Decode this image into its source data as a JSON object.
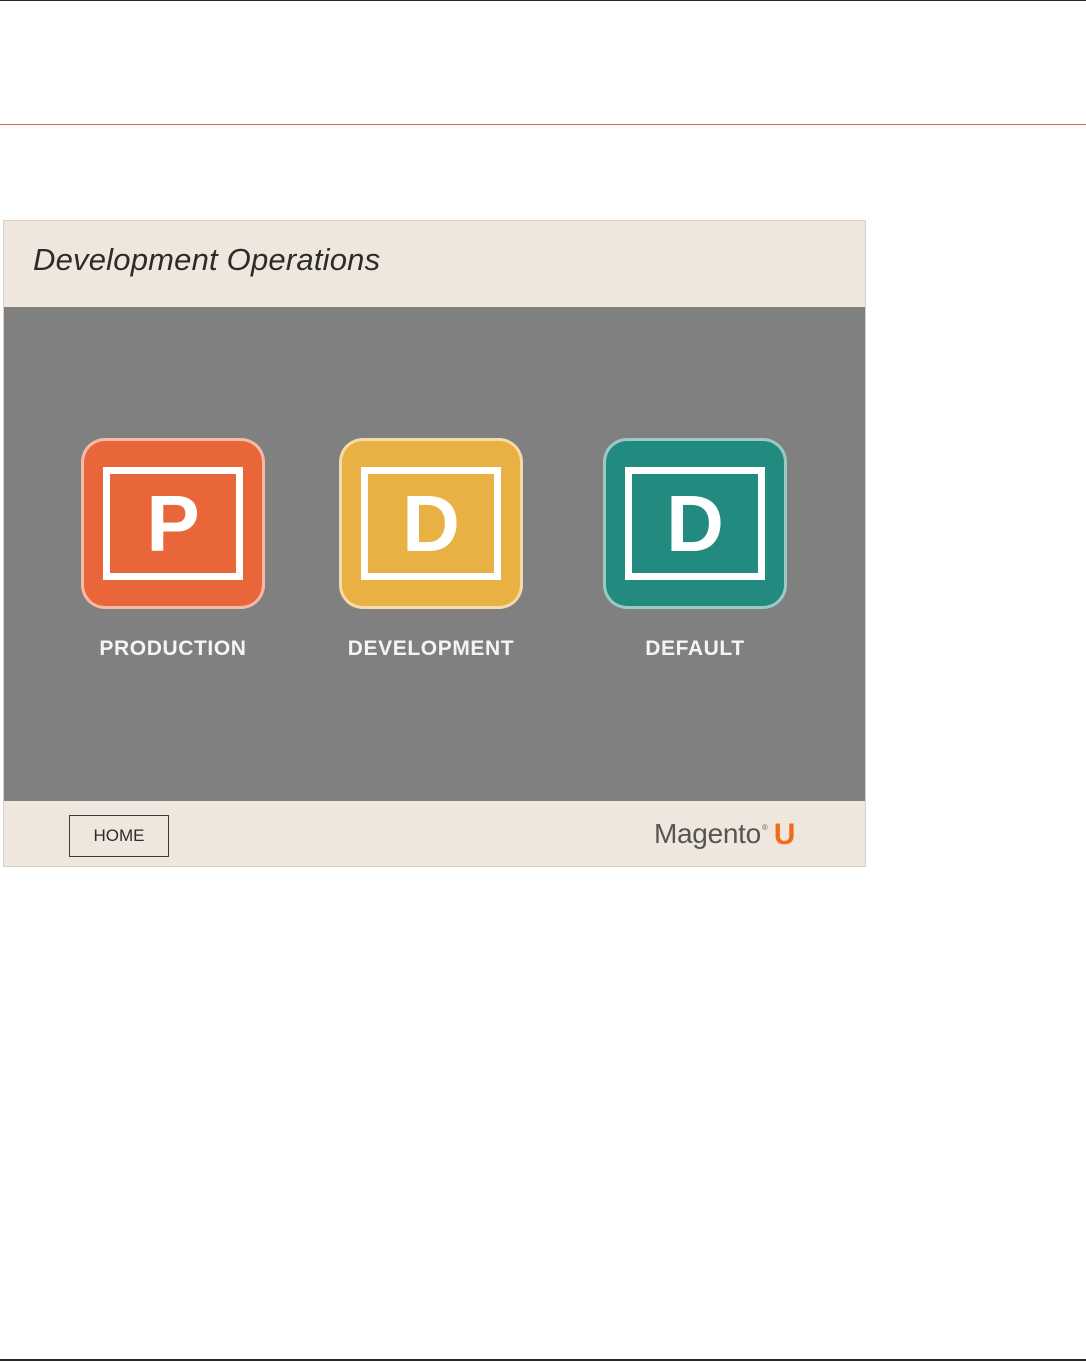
{
  "slide": {
    "title": "Development Operations"
  },
  "modes": [
    {
      "letter": "P",
      "label": "PRODUCTION",
      "color": "#e8663a"
    },
    {
      "letter": "D",
      "label": "DEVELOPMENT",
      "color": "#e9b044"
    },
    {
      "letter": "D",
      "label": "DEFAULT",
      "color": "#228a7f"
    }
  ],
  "footer": {
    "home_label": "HOME",
    "logo": {
      "word": "Magento",
      "mark": "®",
      "u": "U"
    }
  },
  "colors": {
    "accent_rule": "#d9673a",
    "stage_background": "#808080",
    "panel_background": "#efe7de",
    "logo_u": "#f26b1d"
  }
}
